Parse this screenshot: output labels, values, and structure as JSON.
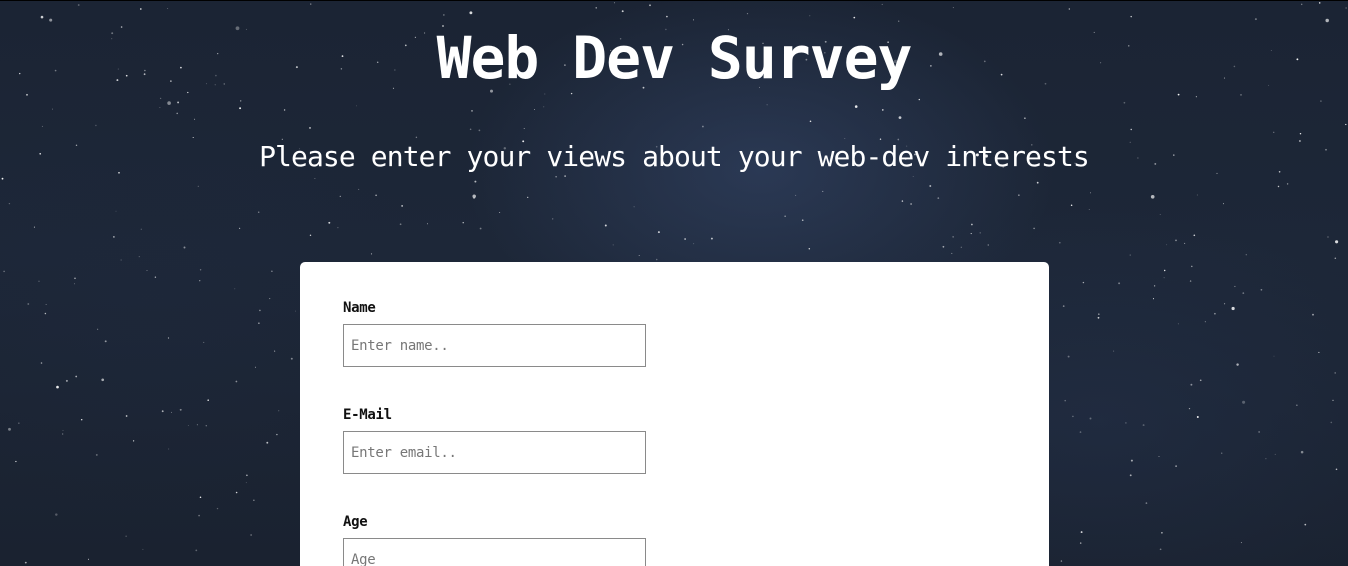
{
  "header": {
    "title": "Web Dev Survey",
    "description": "Please enter your views about your web-dev interests"
  },
  "form": {
    "name": {
      "label": "Name",
      "placeholder": "Enter name..",
      "value": ""
    },
    "email": {
      "label": "E-Mail",
      "placeholder": "Enter email..",
      "value": ""
    },
    "age": {
      "label": "Age",
      "placeholder": "Age",
      "value": ""
    }
  },
  "colors": {
    "background": "#1b2434",
    "card": "#ffffff",
    "text_on_background": "#ffffff",
    "input_border": "#8a8a8a"
  }
}
